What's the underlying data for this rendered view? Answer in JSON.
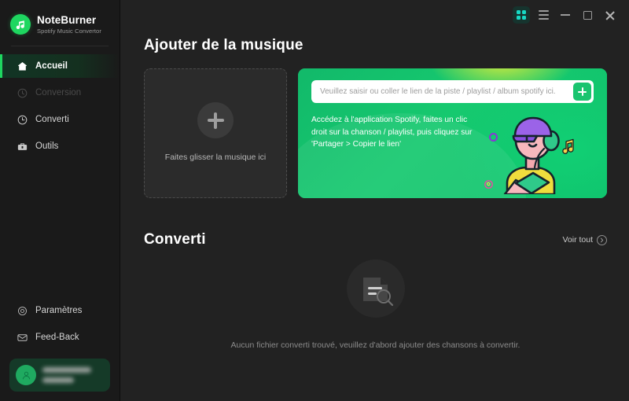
{
  "brand": {
    "title": "NoteBurner",
    "subtitle": "Spotify Music Convertor",
    "logo_icon": "music-note-icon",
    "accent": "#1ed760"
  },
  "titlebar": {
    "buttons": [
      {
        "name": "grid-view-button",
        "icon": "grid-icon"
      },
      {
        "name": "menu-button",
        "icon": "hamburger-icon"
      },
      {
        "name": "minimize-button",
        "icon": "minimize-icon"
      },
      {
        "name": "maximize-button",
        "icon": "maximize-icon"
      },
      {
        "name": "close-button",
        "icon": "close-icon"
      }
    ]
  },
  "sidebar": {
    "items": [
      {
        "label": "Accueil",
        "icon": "home-icon",
        "state": "active"
      },
      {
        "label": "Conversion",
        "icon": "refresh-icon",
        "state": "disabled"
      },
      {
        "label": "Converti",
        "icon": "clock-icon",
        "state": "normal"
      },
      {
        "label": "Outils",
        "icon": "toolbox-icon",
        "state": "normal"
      }
    ],
    "bottom_items": [
      {
        "label": "Paramètres",
        "icon": "gear-icon"
      },
      {
        "label": "Feed-Back",
        "icon": "envelope-icon"
      }
    ],
    "account": {
      "avatar_icon": "user-icon",
      "name_masked": "",
      "plan_masked": ""
    }
  },
  "main": {
    "add_music": {
      "title": "Ajouter de la musique",
      "dropzone": {
        "icon": "plus-icon",
        "text": "Faites glisser la musique ici"
      },
      "banner": {
        "input_placeholder": "Veuillez saisir ou coller le lien de la piste / playlist / album spotify ici.",
        "input_value": "",
        "add_button_icon": "plus-icon",
        "hint": "Accédez à l'application Spotify, faites un clic droit sur la chanson / playlist, puis cliquez sur 'Partager > Copier le lien'",
        "illustration": "person-with-headphones-illustration",
        "decorations": [
          "purple-ring-icon",
          "pink-spiral-icon",
          "yellow-music-note-icon"
        ],
        "colors": {
          "green": "#14c46a",
          "lime_glow": "#d5ea3c"
        }
      }
    },
    "converted": {
      "title": "Converti",
      "see_all_label": "Voir tout",
      "see_all_icon": "chevron-right-icon",
      "empty_icon": "document-search-icon",
      "empty_message": "Aucun fichier converti trouvé, veuillez d'abord ajouter des chansons à convertir."
    }
  }
}
